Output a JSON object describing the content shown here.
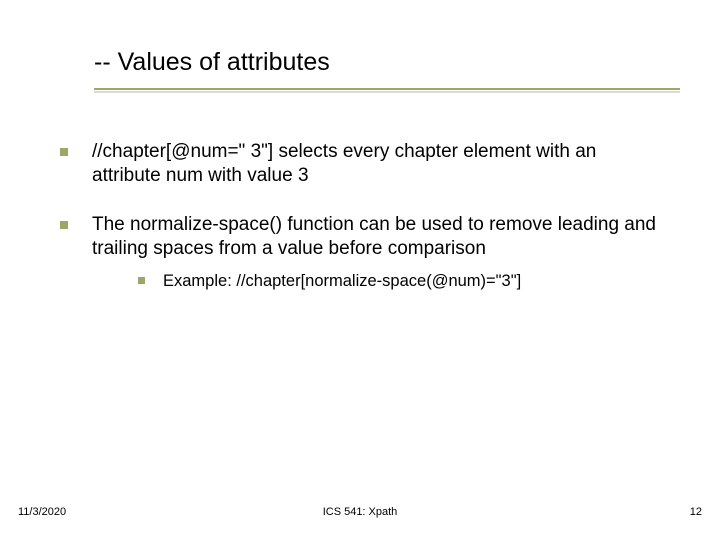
{
  "title": "-- Values of attributes",
  "bullets": [
    {
      "text": "//chapter[@num=\" 3\"] selects every chapter element with an attribute num with value 3"
    },
    {
      "text": "The normalize-space() function can be used to remove leading and trailing spaces from a value before comparison",
      "sub": [
        {
          "text": "Example: //chapter[normalize-space(@num)=\"3\"]"
        }
      ]
    }
  ],
  "footer": {
    "date": "11/3/2020",
    "center": "ICS 541: Xpath",
    "page": "12"
  },
  "colors": {
    "accent": "#99a866"
  }
}
